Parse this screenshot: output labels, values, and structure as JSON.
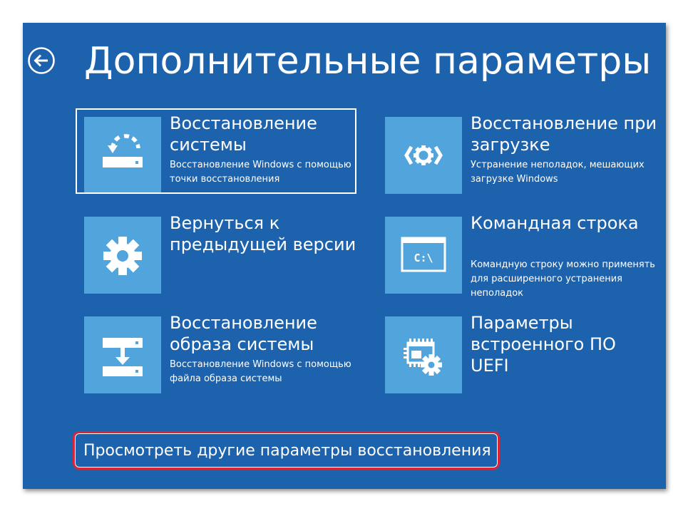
{
  "header": {
    "title": "Дополнительные параметры",
    "back_icon": "back-arrow-icon"
  },
  "tiles": [
    {
      "title": "Восстановление системы",
      "description": "Восстановление Windows с помощью точки восстановления",
      "icon": "system-restore-icon",
      "selected": true
    },
    {
      "title": "Восстановление при загрузке",
      "description": "Устранение неполадок, мешающих загрузке Windows",
      "icon": "startup-repair-icon",
      "selected": false
    },
    {
      "title": "Вернуться к предыдущей версии",
      "description": "",
      "icon": "gear-icon",
      "selected": false
    },
    {
      "title": "Командная строка",
      "description": "Командную строку можно применять для расширенного устранения неполадок",
      "icon": "command-prompt-icon",
      "selected": false
    },
    {
      "title": "Восстановление образа системы",
      "description": "Восстановление Windows с помощью файла образа системы",
      "icon": "system-image-recovery-icon",
      "selected": false
    },
    {
      "title": "Параметры встроенного ПО UEFI",
      "description": "",
      "icon": "uefi-firmware-icon",
      "selected": false
    }
  ],
  "footer": {
    "more_options_label": "Просмотреть другие параметры восстановления"
  },
  "colors": {
    "background": "#1d62ad",
    "tile_icon_bg": "#51a4dc",
    "highlight_border": "#d7263a",
    "text": "#ffffff"
  }
}
